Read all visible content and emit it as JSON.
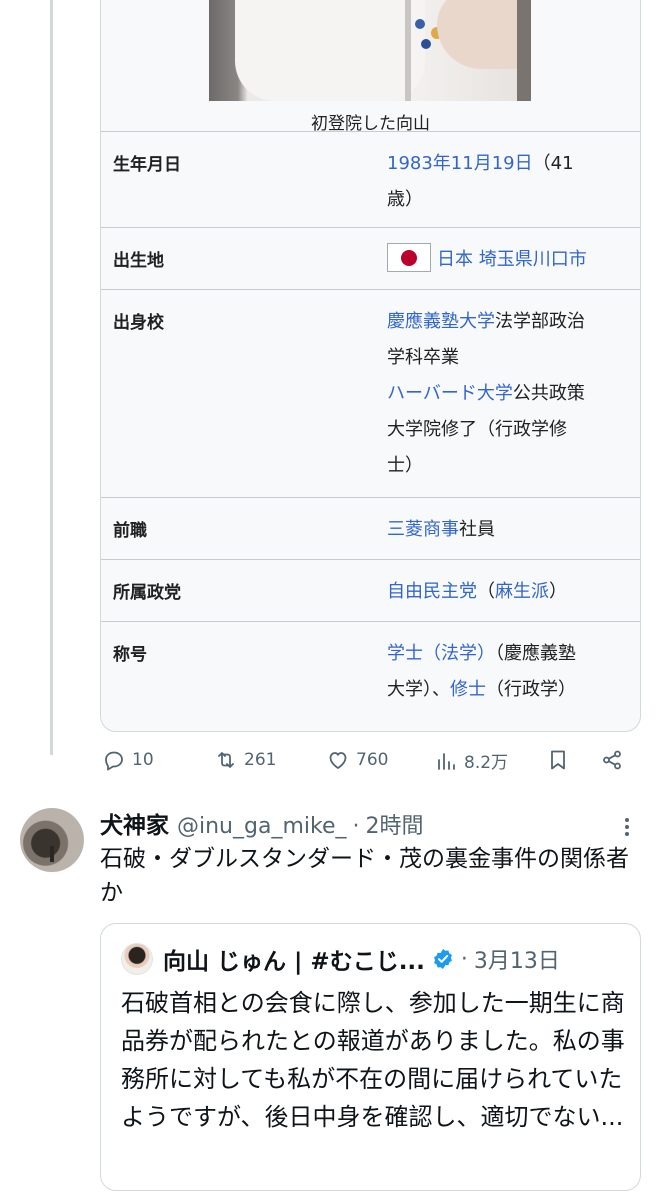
{
  "infobox": {
    "caption": "初登院した向山",
    "rows": [
      {
        "label": "生年月日",
        "value_link": "1983年11月19日",
        "value_text_1": "（41",
        "value_text_2": "歳）"
      },
      {
        "label": "出生地",
        "value_link": "日本 埼玉県川口市"
      },
      {
        "label": "出身校",
        "link1": "慶應義塾大学",
        "text1": "法学部政治",
        "text2": "学科卒業",
        "link2": "ハーバード大学",
        "text3": "公共政策",
        "text4": "大学院修了（行政学修",
        "text5": "士）"
      },
      {
        "label": "前職",
        "value_link": "三菱商事",
        "value_text": "社員"
      },
      {
        "label": "所属政党",
        "value_link": "自由民主党",
        "value_text_a": "（",
        "value_link_2": "麻生派",
        "value_text_b": "）"
      },
      {
        "label": "称号",
        "link1": "学士（法学）",
        "text1": "（慶應義塾",
        "text2": "大学）、",
        "link2": "修士",
        "text3": "（行政学）"
      }
    ]
  },
  "actions": {
    "replies": "10",
    "retweets": "261",
    "likes": "760",
    "views": "8.2万"
  },
  "reply": {
    "name": "犬神家",
    "handle": "@inu_ga_mike_",
    "separator": "·",
    "time": "2時間",
    "text": "石破・ダブルスタンダード・茂の裏金事件の関係者か"
  },
  "quote": {
    "name": "向山 じゅん | #むこじ...",
    "separator": "·",
    "date": "3月13日",
    "text": "石破首相との会食に際し、参加した一期生に商品券が配られたとの報道がありました。私の事務所に対しても私が不在の間に届けられていたようですが、後日中身を確認し、適切でない..."
  },
  "colors": {
    "link": "#3366cc",
    "muted": "#536471",
    "verified": "#1d9bf0"
  }
}
